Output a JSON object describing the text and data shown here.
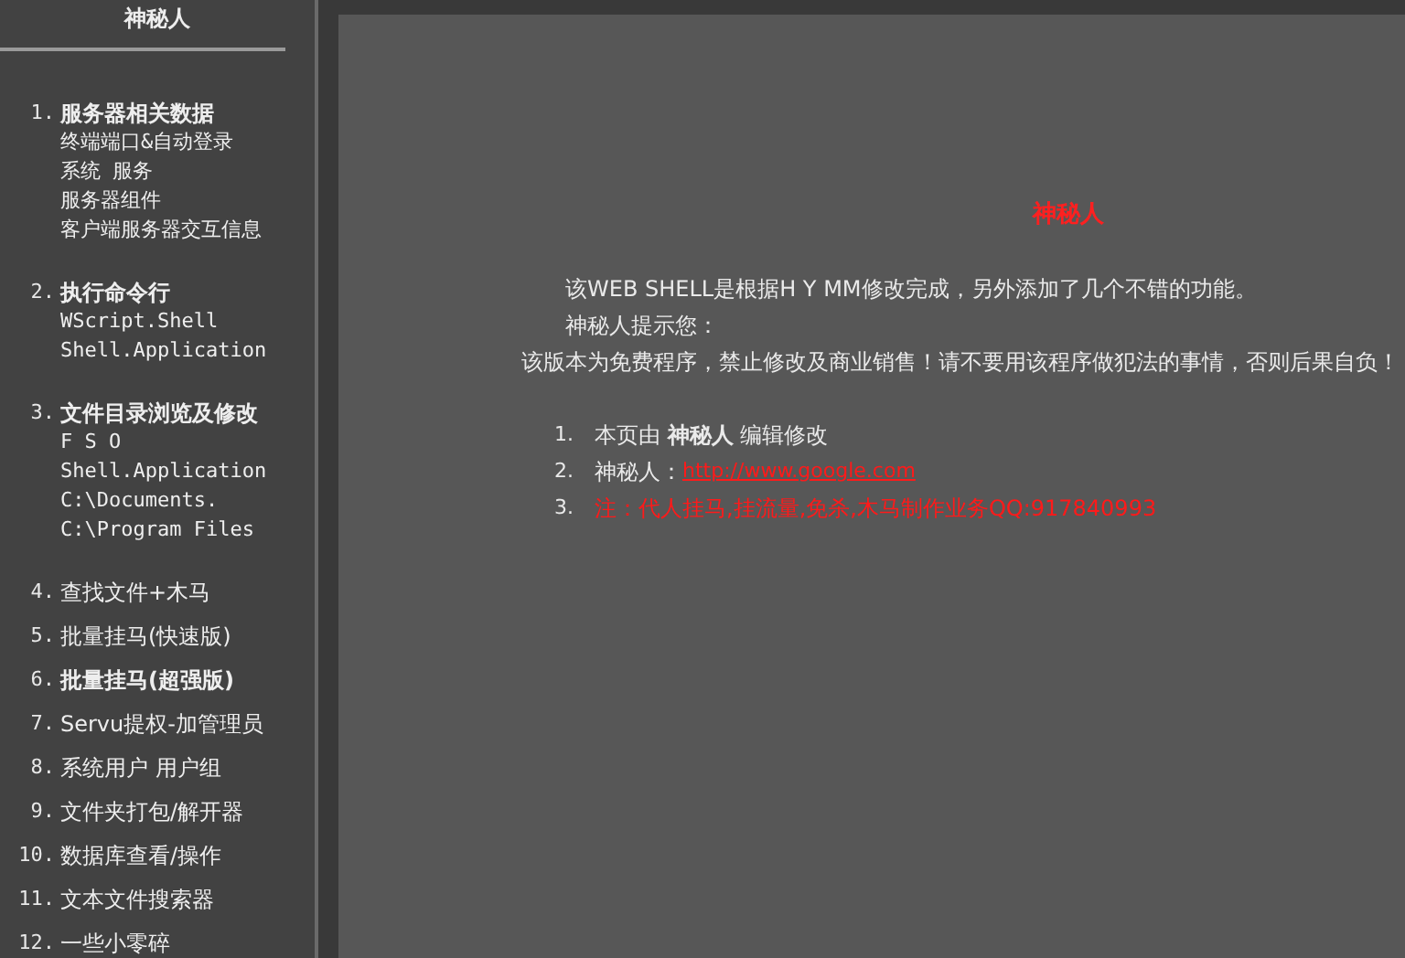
{
  "sidebar": {
    "title": "神秘人",
    "items": [
      {
        "number": "1.",
        "label": "服务器相关数据",
        "bold": true,
        "children": [
          "终端端口&自动登录",
          "系统 服务",
          "服务器组件",
          "客户端服务器交互信息"
        ]
      },
      {
        "number": "2.",
        "label": "执行命令行",
        "bold": true,
        "children": [
          "WScript.Shell",
          "Shell.Application"
        ]
      },
      {
        "number": "3.",
        "label": "文件目录浏览及修改",
        "bold": true,
        "children": [
          "F S O",
          "Shell.Application",
          "C:\\Documents.",
          "C:\\Program Files"
        ]
      },
      {
        "number": "4.",
        "label": "查找文件+木马",
        "bold": false
      },
      {
        "number": "5.",
        "label": "批量挂马(快速版)",
        "bold": false
      },
      {
        "number": "6.",
        "label": "批量挂马(超强版)",
        "bold": true
      },
      {
        "number": "7.",
        "label": "Servu提权-加管理员",
        "bold": false
      },
      {
        "number": "8.",
        "label": "系统用户 用户组",
        "bold": false
      },
      {
        "number": "9.",
        "label": "文件夹打包/解开器",
        "bold": false
      },
      {
        "number": "10.",
        "label": "数据库查看/操作",
        "bold": false
      },
      {
        "number": "11.",
        "label": "文本文件搜索器",
        "bold": false
      },
      {
        "number": "12.",
        "label": "一些小零碎",
        "bold": false
      }
    ]
  },
  "main": {
    "title": "神秘人",
    "paragraphs": [
      {
        "text": "该WEB SHELL是根据H Y MM修改完成，另外添加了几个不错的功能。",
        "kind": "indent"
      },
      {
        "text": "神秘人提示您：",
        "kind": "indent"
      },
      {
        "text": "该版本为免费程序，禁止修改及商业销售！请不要用该程序做犯法的事情，否则后果自负！",
        "kind": "center"
      }
    ],
    "notes": [
      {
        "number": "1.",
        "kind": "text",
        "text": "本页由 **神秘人** 编辑修改"
      },
      {
        "number": "2.",
        "kind": "link",
        "text": "神秘人：",
        "link": "http://www.google.com"
      },
      {
        "number": "3.",
        "kind": "warning",
        "text": "注：代人挂马,挂流量,免杀,木马制作业务QQ:917840993"
      }
    ]
  }
}
